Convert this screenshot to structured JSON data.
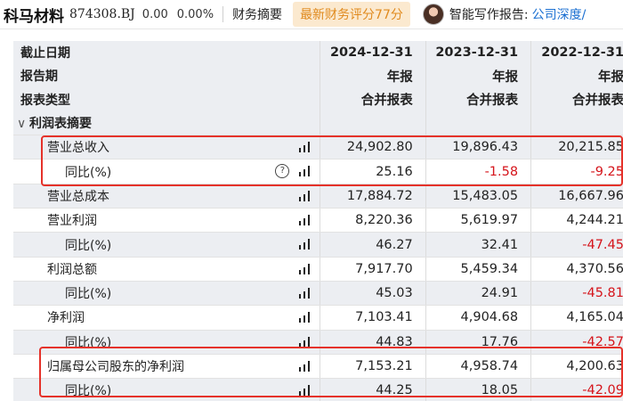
{
  "header": {
    "stock_name": "科马材料",
    "stock_code": "874308.BJ",
    "price": "0.00",
    "change_pct": "0.00%",
    "nav_finance": "财务摘要",
    "score_badge": "最新财务评分77分",
    "ai_label": "智能写作报告:",
    "ai_link": "公司深度/"
  },
  "table": {
    "header_rows": [
      {
        "label": "截止日期",
        "values": [
          "2024-12-31",
          "2023-12-31",
          "2022-12-31"
        ]
      },
      {
        "label": "报告期",
        "values": [
          "年报",
          "年报",
          "年报"
        ]
      },
      {
        "label": "报表类型",
        "values": [
          "合并报表",
          "合并报表",
          "合并报表"
        ]
      }
    ],
    "section_title": "利润表摘要",
    "rows": [
      {
        "label": "营业总收入",
        "values": [
          "24,902.80",
          "19,896.43",
          "20,215.85"
        ]
      },
      {
        "label": "同比(%)",
        "values": [
          "25.16",
          "-1.58",
          "-9.25"
        ]
      },
      {
        "label": "营业总成本",
        "values": [
          "17,884.72",
          "15,483.05",
          "16,667.96"
        ]
      },
      {
        "label": "营业利润",
        "values": [
          "8,220.36",
          "5,619.97",
          "4,244.21"
        ]
      },
      {
        "label": "同比(%)",
        "values": [
          "46.27",
          "32.41",
          "-47.45"
        ]
      },
      {
        "label": "利润总额",
        "values": [
          "7,917.70",
          "5,459.34",
          "4,370.56"
        ]
      },
      {
        "label": "同比(%)",
        "values": [
          "45.03",
          "24.91",
          "-45.81"
        ]
      },
      {
        "label": "净利润",
        "values": [
          "7,103.41",
          "4,904.68",
          "4,165.04"
        ]
      },
      {
        "label": "同比(%)",
        "values": [
          "44.83",
          "17.76",
          "-42.57"
        ]
      },
      {
        "label": "归属母公司股东的净利润",
        "values": [
          "7,153.21",
          "4,958.74",
          "4,200.63"
        ]
      },
      {
        "label": "同比(%)",
        "values": [
          "44.25",
          "18.05",
          "-42.09"
        ]
      }
    ]
  },
  "icons": {
    "bar_chart": "bar-chart-icon",
    "help": "help-circle-icon",
    "collapse": "chevron-down-icon"
  },
  "colors": {
    "negative": "#d5141b",
    "highlight_border": "#e5322a",
    "badge_text": "#e08a1e",
    "link": "#1a6fd1"
  }
}
